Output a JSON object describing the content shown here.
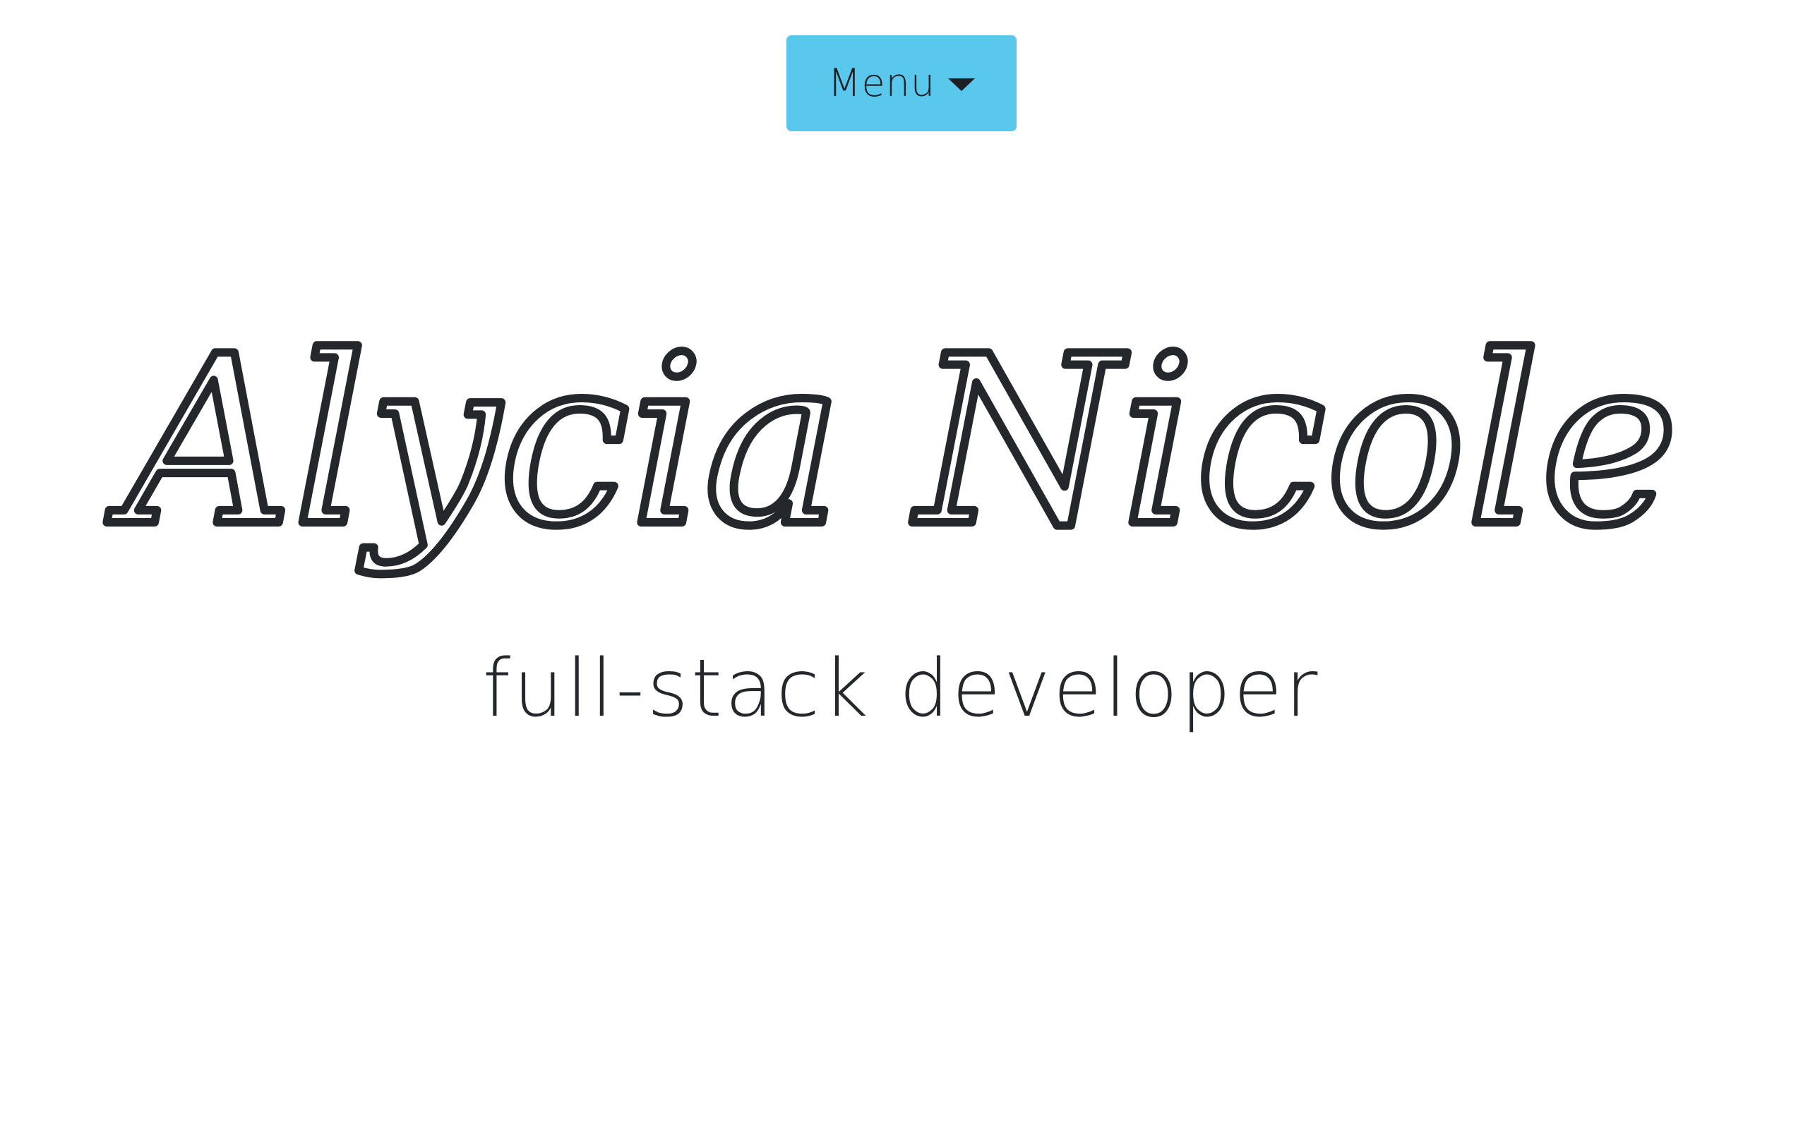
{
  "nav": {
    "menu_label": "Menu",
    "menu_icon": "caret-down-icon"
  },
  "hero": {
    "name": "Alycia Nicole",
    "tagline": "full-stack developer"
  },
  "colors": {
    "menu_background": "#5ac8ec",
    "text": "#24272c",
    "page_background": "#ffffff"
  }
}
